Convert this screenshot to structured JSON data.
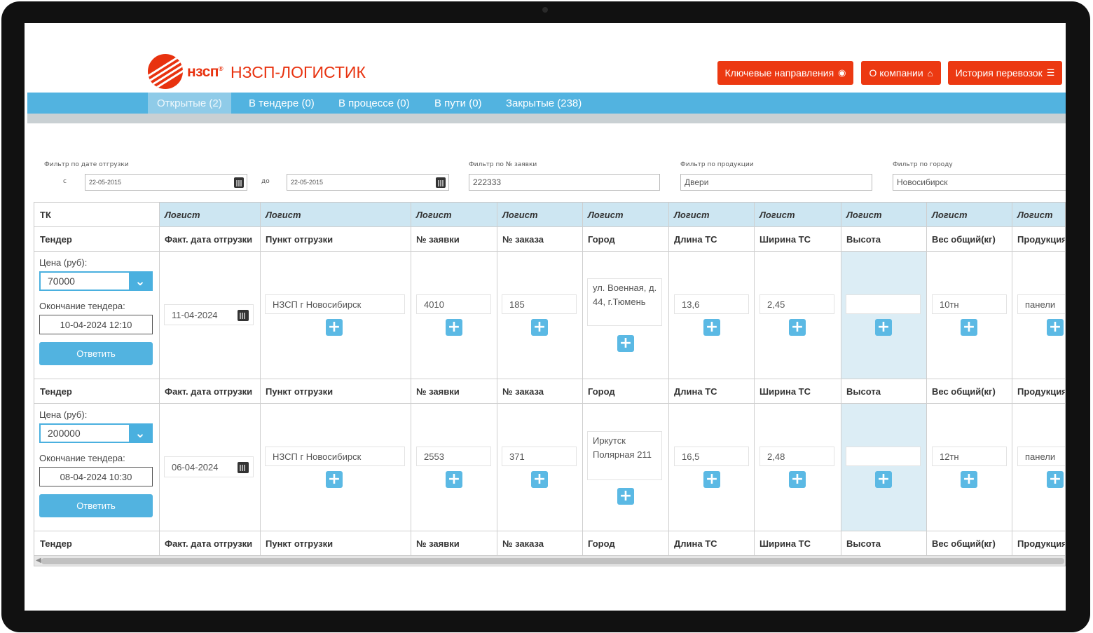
{
  "header": {
    "brand_short": "нзсп",
    "brand_name": "НЗСП-ЛОГИСТИК",
    "buttons": [
      {
        "label": "Ключевые направления",
        "icon": "globe-icon"
      },
      {
        "label": "О компании",
        "icon": "home-icon"
      },
      {
        "label": "История перевозок",
        "icon": "list-icon"
      }
    ]
  },
  "nav": {
    "tabs": [
      {
        "label": "Открытые (2)",
        "active": true
      },
      {
        "label": "В тендере (0)",
        "active": false
      },
      {
        "label": "В процессе (0)",
        "active": false
      },
      {
        "label": "В пути (0)",
        "active": false
      },
      {
        "label": "Закрытые (238)",
        "active": false
      }
    ]
  },
  "filters": {
    "date_label": "Фильтр по дате отгрузки",
    "from_label": "с",
    "from_value": "22-05-2015",
    "to_label": "до",
    "to_value": "22-05-2015",
    "order_label": "Фильтр по № заявки",
    "order_value": "222333",
    "product_label": "Фильтр по продукции",
    "product_value": "Двери",
    "city_label": "Фильтр по городу",
    "city_value": "Новосибирск"
  },
  "table": {
    "tk_label": "ТК",
    "logist_label": "Логист",
    "columns": [
      "Тендер",
      "Факт. дата отгрузки",
      "Пункт отгрузки",
      "№ заявки",
      "№ заказа",
      "Город",
      "Длина ТС",
      "Ширина ТС",
      "Высота",
      "Вес общий(кг)",
      "Продукция"
    ],
    "price_label": "Цена (руб):",
    "end_label": "Окончание тендера:",
    "answer_label": "Ответить",
    "rows": [
      {
        "price": "70000",
        "end": "10-04-2024 12:10",
        "date": "11-04-2024",
        "point": "НЗСП г Новосибирск",
        "order_no": "4010",
        "zakaz_no": "185",
        "city": "ул. Военная, д. 44, г.Тюмень",
        "length": "13,6",
        "width": "2,45",
        "height": "",
        "weight": "10тн",
        "product": "панели"
      },
      {
        "price": "200000",
        "end": "08-04-2024 10:30",
        "date": "06-04-2024",
        "point": "НЗСП г Новосибирск",
        "order_no": "2553",
        "zakaz_no": "371",
        "city": "Иркутск Полярная 211",
        "length": "16,5",
        "width": "2,48",
        "height": "",
        "weight": "12тн",
        "product": "панели"
      }
    ]
  },
  "colors": {
    "brand_red": "#e8320f",
    "nav_blue": "#52b3e0",
    "header_blue": "#cde6f2"
  }
}
